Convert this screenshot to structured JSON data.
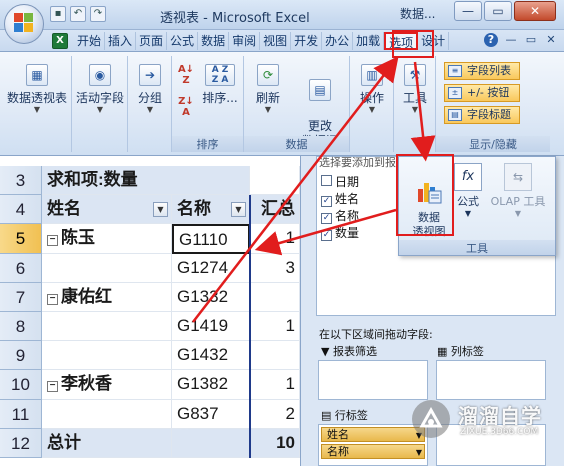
{
  "window": {
    "title": "透视表 - Microsoft Excel",
    "title_extra": "数据...",
    "buttons": {
      "minimize": "—",
      "restore": "▭",
      "close": "✕"
    }
  },
  "tabs": [
    "开始",
    "插入",
    "页面",
    "公式",
    "数据",
    "审阅",
    "视图",
    "开发",
    "办公",
    "加载",
    "选项",
    "设计"
  ],
  "active_tab_index": 10,
  "ribbon": {
    "groups": [
      {
        "name": "pivot",
        "label": "",
        "buttons": [
          "数据透视表"
        ]
      },
      {
        "name": "active-field",
        "label": "",
        "buttons": [
          "活动字段"
        ]
      },
      {
        "name": "group",
        "label": "",
        "buttons": [
          "分组"
        ]
      },
      {
        "name": "sort",
        "label": "排序",
        "buttons": [
          "排序..."
        ]
      },
      {
        "name": "data",
        "label": "数据",
        "buttons": [
          "刷新",
          "更改\n数据源"
        ]
      },
      {
        "name": "actions",
        "label": "",
        "buttons": [
          "操作"
        ]
      },
      {
        "name": "tools",
        "label": "",
        "buttons": [
          "工具"
        ]
      },
      {
        "name": "show-hide",
        "label": "显示/隐藏",
        "buttons": [
          "字段列表",
          "+/- 按钮",
          "字段标题"
        ]
      }
    ]
  },
  "tools_popup": {
    "buttons": [
      "数据\n透视图",
      "公式",
      "OLAP 工具"
    ],
    "label": "工具"
  },
  "sheet": {
    "rows": [
      {
        "num": "3",
        "a": "求和项:数量",
        "b": "",
        "c": ""
      },
      {
        "num": "4",
        "a": "姓名",
        "b": "名称",
        "c": "汇总"
      },
      {
        "num": "5",
        "a": "陈玉",
        "b": "G1110",
        "c": "1"
      },
      {
        "num": "6",
        "a": "",
        "b": "G1274",
        "c": "3"
      },
      {
        "num": "7",
        "a": "康佑红",
        "b": "G1332",
        "c": ""
      },
      {
        "num": "8",
        "a": "",
        "b": "G1419",
        "c": "1"
      },
      {
        "num": "9",
        "a": "",
        "b": "G1432",
        "c": ""
      },
      {
        "num": "10",
        "a": "李秋香",
        "b": "G1382",
        "c": "1"
      },
      {
        "num": "11",
        "a": "",
        "b": "G837",
        "c": "2"
      },
      {
        "num": "12",
        "a": "总计",
        "b": "",
        "c": "10"
      }
    ]
  },
  "field_list": {
    "header_partial": "选择要添加到报表",
    "fields": [
      {
        "label": "日期",
        "checked": false,
        "mark": ""
      },
      {
        "label": "姓名",
        "checked": true,
        "mark": "✓"
      },
      {
        "label": "名称",
        "checked": true,
        "mark": "✓"
      },
      {
        "label": "数量",
        "checked": true,
        "mark": "✓"
      }
    ],
    "drag_hint": "在以下区域间拖动字段:",
    "report_filter": "报表筛选",
    "column_labels": "列标签",
    "row_labels": "行标签",
    "row_items": [
      "姓名",
      "名称"
    ]
  },
  "watermark": {
    "title": "溜溜自学",
    "sub": "ZIXUE.3D66.COM"
  },
  "colors": {
    "highlight": "#e11d1d",
    "ribbon": "#dfe9f6",
    "selected_row_header": "#f1c052"
  }
}
